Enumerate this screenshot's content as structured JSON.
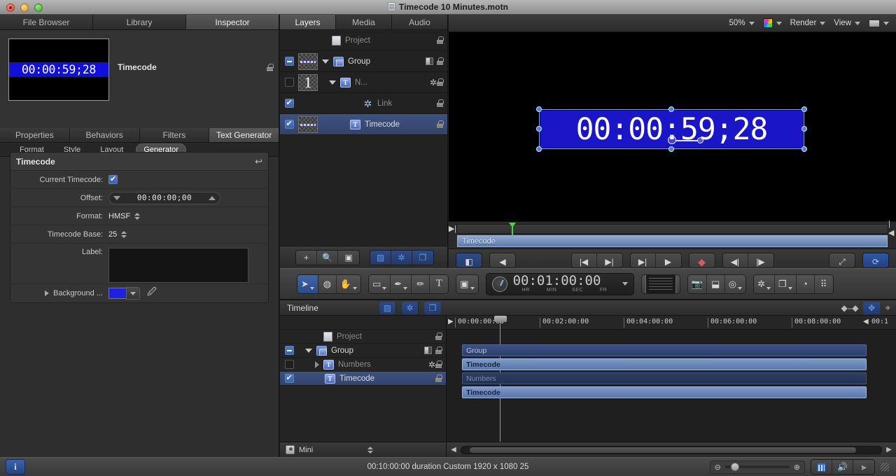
{
  "window": {
    "title": "Timecode 10 Minutes.motn",
    "traffic_lights": [
      "close",
      "minimize",
      "zoom"
    ]
  },
  "inspector": {
    "tabs": [
      {
        "label": "File Browser",
        "active": false
      },
      {
        "label": "Library",
        "active": false
      },
      {
        "label": "Inspector",
        "active": true
      }
    ],
    "preview_timecode": "00:00:59;28",
    "object_name": "Timecode",
    "category_tabs": [
      {
        "label": "Properties",
        "active": false
      },
      {
        "label": "Behaviors",
        "active": false
      },
      {
        "label": "Filters",
        "active": false
      },
      {
        "label": "Text Generator",
        "active": true
      }
    ],
    "sub_tabs": [
      {
        "label": "Format",
        "active": false
      },
      {
        "label": "Style",
        "active": false
      },
      {
        "label": "Layout",
        "active": false
      },
      {
        "label": "Generator",
        "active": true
      }
    ],
    "params": {
      "group_title": "Timecode",
      "current_timecode_label": "Current Timecode:",
      "current_timecode_checked": true,
      "offset_label": "Offset:",
      "offset_value": "00:00:00;00",
      "format_label": "Format:",
      "format_value": "HMSF",
      "timecode_base_label": "Timecode Base:",
      "timecode_base_value": "25",
      "label_label": "Label:",
      "label_value": "",
      "background_label": "Background ...",
      "background_color": "#2020e0"
    }
  },
  "layers_panel": {
    "tabs": [
      {
        "label": "Layers",
        "active": true
      },
      {
        "label": "Media",
        "active": false
      },
      {
        "label": "Audio",
        "active": false
      }
    ],
    "rows": [
      {
        "name": "Project",
        "icon": "project-doc-icon",
        "dim": true,
        "checkbox": "none",
        "thumb": "none",
        "arrow": "none",
        "selected": false,
        "gear": false,
        "mask": false
      },
      {
        "name": "Group",
        "icon": "group-icon",
        "dim": false,
        "checkbox": "minus",
        "thumb": "dash",
        "arrow": "down",
        "selected": false,
        "gear": false,
        "mask": true
      },
      {
        "name": "N...",
        "icon": "text-icon",
        "dim": true,
        "checkbox": "off",
        "thumb": "one",
        "arrow": "down",
        "selected": false,
        "gear": true,
        "mask": false
      },
      {
        "name": "Link",
        "icon": "link-gear-icon",
        "dim": true,
        "checkbox": "on",
        "thumb": "none",
        "arrow": "none",
        "selected": false,
        "gear": false,
        "mask": false
      },
      {
        "name": "Timecode",
        "icon": "text-icon",
        "dim": false,
        "checkbox": "on",
        "thumb": "dash",
        "arrow": "none",
        "selected": true,
        "gear": false,
        "mask": false
      }
    ],
    "toolbar": {
      "add": "+",
      "search": "search-icon",
      "mask": "mask-icon",
      "view_toggles": [
        "checker-icon",
        "gear-icon",
        "layers-icon"
      ]
    }
  },
  "canvas": {
    "toolbar": {
      "zoom_level": "50%",
      "render_label": "Render",
      "view_label": "View"
    },
    "timecode_text": "00:00:59;28",
    "mini_timeline_clip": "Timecode",
    "transport": {
      "buttons": [
        "project-pane",
        "timing-pane",
        "go-start",
        "go-end",
        "play-range",
        "play",
        "record",
        "step-back",
        "step-forward",
        "fullscreen",
        "loop"
      ]
    }
  },
  "main_toolbar": {
    "tools": [
      "select-tool",
      "3d-transform-tool",
      "pan-tool",
      "rectangle-tool",
      "bezier-pen-tool",
      "paint-stroke-tool",
      "text-tool",
      "mask-tool"
    ],
    "current_time": "00:01:00:00",
    "time_units": [
      "HR",
      "MIN",
      "SEC",
      "FR"
    ],
    "right_tools": [
      "hud",
      "camera",
      "retime",
      "behaviors",
      "keyframe",
      "gear-menu",
      "layers-menu",
      "mask-menu",
      "grid-menu"
    ]
  },
  "timeline": {
    "title": "Timeline",
    "layers": [
      {
        "name": "Project",
        "dim": true,
        "checkbox": "none",
        "arrow": "none",
        "icon": "project-doc-icon",
        "selected": false,
        "gear": false,
        "mask": false
      },
      {
        "name": "Group",
        "dim": false,
        "checkbox": "minus",
        "arrow": "down",
        "icon": "group-icon",
        "selected": false,
        "gear": false,
        "mask": true
      },
      {
        "name": "Numbers",
        "dim": true,
        "checkbox": "off",
        "arrow": "right",
        "icon": "text-icon",
        "selected": false,
        "gear": true,
        "mask": false
      },
      {
        "name": "Timecode",
        "dim": false,
        "checkbox": "on",
        "arrow": "none",
        "icon": "text-icon",
        "selected": true,
        "gear": false,
        "mask": false
      }
    ],
    "ruler_ticks": [
      "00:00:00:00",
      "00:02:00:00",
      "00:04:00:00",
      "00:06:00:00",
      "00:08:00:00",
      "00:1"
    ],
    "clips": [
      {
        "name": "Group",
        "style": "group"
      },
      {
        "name": "Timecode",
        "style": "sel"
      },
      {
        "name": "Numbers",
        "style": "dim"
      },
      {
        "name": "Timecode",
        "style": "sel"
      }
    ],
    "mini_popup": "Mini"
  },
  "statusbar": {
    "info_glyph": "i",
    "status_text": "00:10:00:00 duration Custom 1920 x 1080 25",
    "right_buttons": [
      "film-icon",
      "audio-icon",
      "render-icon"
    ]
  }
}
